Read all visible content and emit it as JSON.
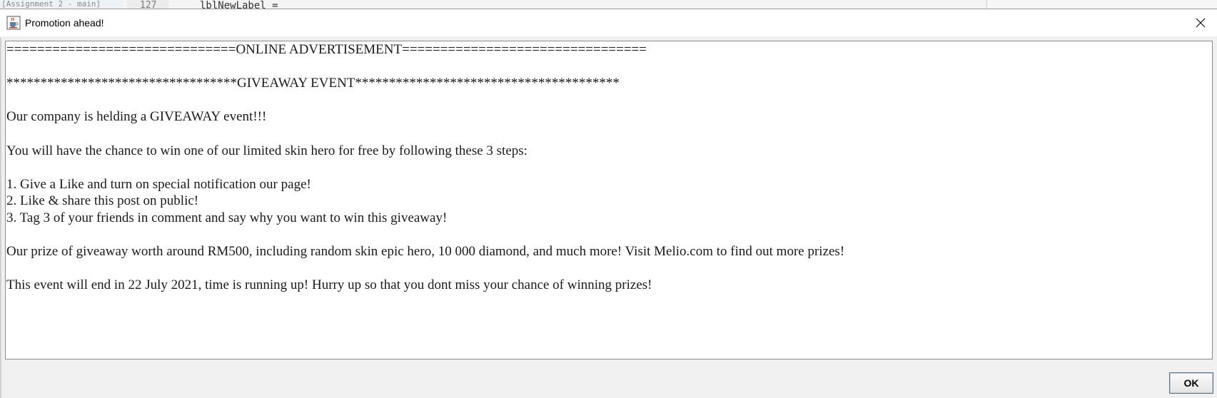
{
  "background": {
    "left_text": "[Assignment 2 - main]",
    "line_number": "127",
    "code_text": "lblNewLabel ="
  },
  "dialog": {
    "title": "Promotion ahead!",
    "title_icon": "java-coffee-cup-icon",
    "close_icon": "close-icon",
    "ok_label": "OK"
  },
  "message": {
    "lines": [
      "==============================ONLINE ADVERTISEMENT================================",
      "",
      "**********************************GIVEAWAY EVENT***************************************",
      "",
      "Our company is helding a GIVEAWAY event!!!",
      "",
      "You will have the chance to win one of our limited skin hero for free by following these 3 steps:",
      "",
      "1. Give a Like and turn on special notification our page!",
      "2. Like & share this post on public!",
      "3. Tag 3 of your friends in comment and say why you want to win this giveaway!",
      "",
      "Our prize of giveaway worth around RM500, including random skin epic hero, 10 000 diamond, and much more! Visit Melio.com to find out more prizes!",
      "",
      "This event will end in 22 July 2021, time is running up! Hurry up so that you dont miss your chance of winning prizes!"
    ]
  },
  "colors": {
    "dialog_bg": "#f0f0f0",
    "titlebar_bg": "#ffffff",
    "text": "#1a1a1a"
  }
}
